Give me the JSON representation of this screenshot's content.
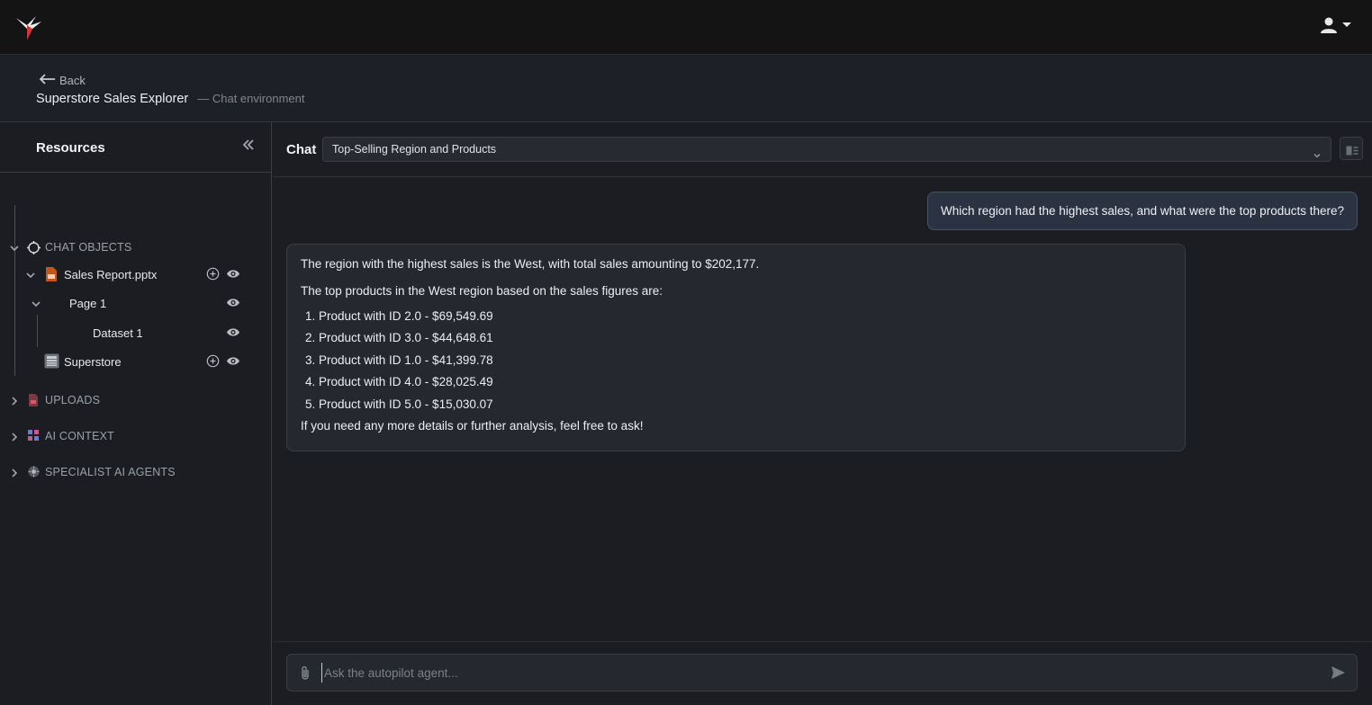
{
  "app": {
    "back_label": "Back",
    "title": "Superstore Sales Explorer",
    "subtitle": "— Chat environment"
  },
  "sidebar": {
    "title": "Resources",
    "sections": {
      "chat_objects": "CHAT OBJECTS",
      "uploads": "UPLOADS",
      "ai_context": "AI CONTEXT",
      "specialist_agents": "SPECIALIST AI AGENTS"
    },
    "items": {
      "sales_report": "Sales Report.pptx",
      "page1": "Page 1",
      "dataset1": "Dataset 1",
      "superstore": "Superstore"
    }
  },
  "chat": {
    "label": "Chat",
    "session_name": "Top-Selling Region and Products",
    "user_message": "Which region had the highest sales, and what were the top products there?",
    "assistant": {
      "intro": "The region with the highest sales is the West, with total sales amounting to $202,177.",
      "lead": "The top products in the West region based on the sales figures are:",
      "list": [
        "1. Product with ID 2.0 - $69,549.69",
        "2. Product with ID 3.0 - $44,648.61",
        "3. Product with ID 1.0 - $41,399.78",
        "4. Product with ID 4.0 - $28,025.49",
        "5. Product with ID 5.0 - $15,030.07"
      ],
      "closing": "If you need any more details or further analysis, feel free to ask!"
    },
    "composer_placeholder": "Ask the autopilot agent..."
  },
  "colors": {
    "accent_red": "#d9303a",
    "user_bubble": "#2b3342",
    "assistant_bubble": "#25282e"
  },
  "icons": [
    "hummingbird-logo-icon",
    "user-icon",
    "arrow-left-icon",
    "double-chevron-left-icon",
    "chevron-down-icon",
    "chevron-right-icon",
    "target-icon",
    "pptx-file-icon",
    "table-icon",
    "upload-icon",
    "context-icon",
    "agent-icon",
    "plus-circle-icon",
    "eye-icon",
    "layout-icon",
    "paperclip-icon",
    "send-icon"
  ]
}
